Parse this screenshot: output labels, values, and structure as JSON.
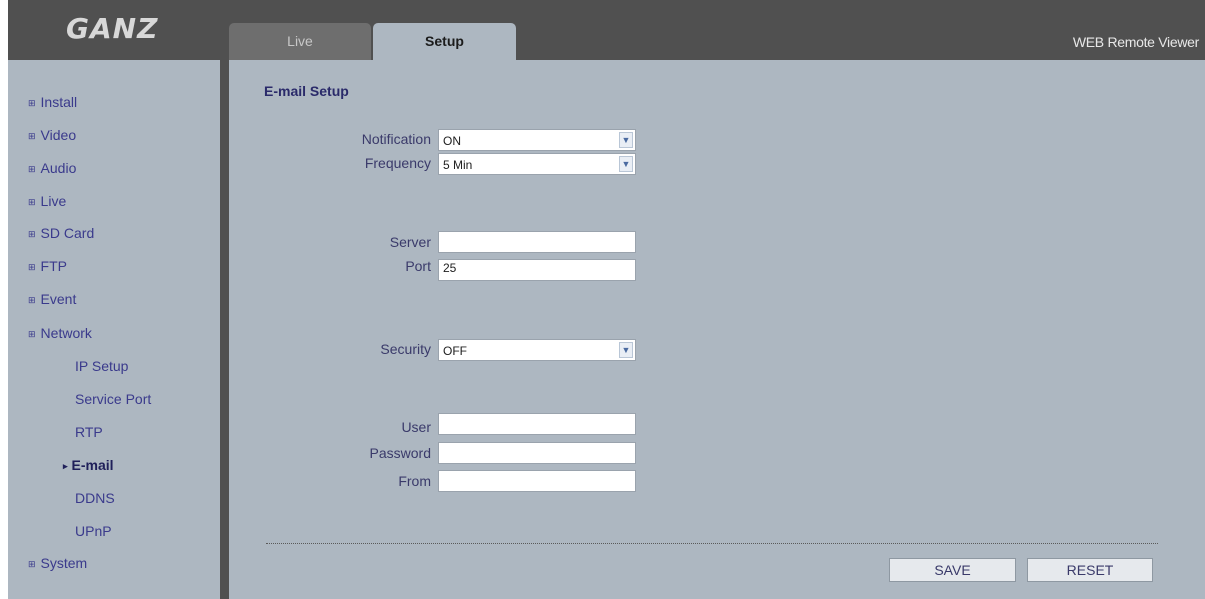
{
  "header": {
    "logo_text": "GANZ",
    "app_title": "WEB Remote Viewer",
    "tabs": [
      {
        "label": "Live",
        "active": false
      },
      {
        "label": "Setup",
        "active": true
      }
    ]
  },
  "sidebar": {
    "bullet_icon": "square-bullet-icon",
    "items": [
      {
        "label": "Install"
      },
      {
        "label": "Video"
      },
      {
        "label": "Audio"
      },
      {
        "label": "Live"
      },
      {
        "label": "SD Card"
      },
      {
        "label": "FTP"
      },
      {
        "label": "Event"
      },
      {
        "label": "Network"
      },
      {
        "label": "System"
      }
    ],
    "network_subitems": [
      {
        "label": "IP Setup",
        "active": false
      },
      {
        "label": "Service Port",
        "active": false
      },
      {
        "label": "RTP",
        "active": false
      },
      {
        "label": "E-mail",
        "active": true
      },
      {
        "label": "DDNS",
        "active": false
      },
      {
        "label": "UPnP",
        "active": false
      }
    ]
  },
  "main": {
    "title": "E-mail Setup",
    "fields": {
      "notification": {
        "label": "Notification",
        "value": "ON"
      },
      "frequency": {
        "label": "Frequency",
        "value": "5 Min"
      },
      "server": {
        "label": "Server",
        "value": ""
      },
      "port": {
        "label": "Port",
        "value": "25"
      },
      "security": {
        "label": "Security",
        "value": "OFF"
      },
      "user": {
        "label": "User",
        "value": ""
      },
      "password": {
        "label": "Password",
        "value": ""
      },
      "from": {
        "label": "From",
        "value": ""
      }
    },
    "buttons": {
      "save": "SAVE",
      "reset": "RESET"
    }
  },
  "colors": {
    "frame_bg": "#505050",
    "panel_bg": "#adb7c1",
    "link_text": "#3a3a8c"
  }
}
